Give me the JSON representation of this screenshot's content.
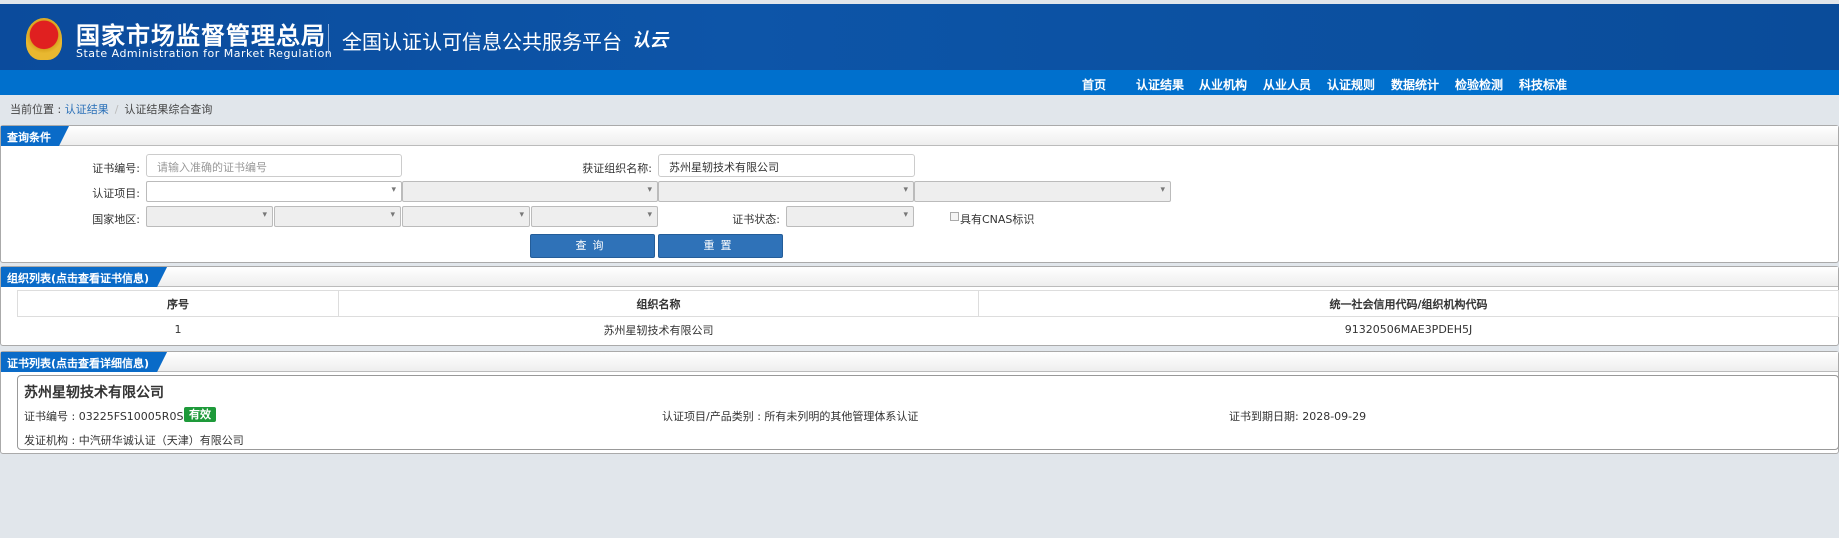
{
  "header": {
    "agency_cn": "国家市场监督管理总局",
    "agency_en": "State Administration  for  Market Regulation",
    "platform": "全国认证认可信息公共服务平台",
    "cloud_logo": "认云",
    "emblem": "national-emblem-icon"
  },
  "nav": {
    "items": [
      "首页",
      "认证结果",
      "从业机构",
      "从业人员",
      "认证规则",
      "数据统计",
      "检验检测",
      "科技标准"
    ]
  },
  "breadcrumb": {
    "prefix": "当前位置 : ",
    "link": "认证结果",
    "sep": "/",
    "current": "认证结果综合查询"
  },
  "query": {
    "title": "查询条件",
    "cert_no_label": "证书编号:",
    "cert_no_placeholder": "请输入准确的证书编号",
    "cert_no_value": "",
    "org_label": "获证组织名称:",
    "org_value": "苏州星轫技术有限公司",
    "project_label": "认证项目:",
    "region_label": "国家地区:",
    "status_label": "证书状态:",
    "cnas_label": "具有CNAS标识",
    "cnas_checked": false,
    "search_btn": "查询",
    "reset_btn": "重置"
  },
  "org_list": {
    "title": "组织列表(点击查看证书信息)",
    "columns": [
      "序号",
      "组织名称",
      "统一社会信用代码/组织机构代码"
    ],
    "rows": [
      [
        "1",
        "苏州星轫技术有限公司",
        "91320506MAE3PDEH5J"
      ]
    ]
  },
  "cert_list": {
    "title": "证书列表(点击查看详细信息)",
    "org_name": "苏州星轫技术有限公司",
    "cert_no": "证书编号 : 03225FS10005R0S",
    "status": "有效",
    "status_color": "#1e9a3a",
    "category": "认证项目/产品类别 : 所有未列明的其他管理体系认证",
    "expiry": "证书到期日期: 2028-09-29",
    "issuer": "发证机构 : 中汽研华诚认证（天津）有限公司"
  }
}
